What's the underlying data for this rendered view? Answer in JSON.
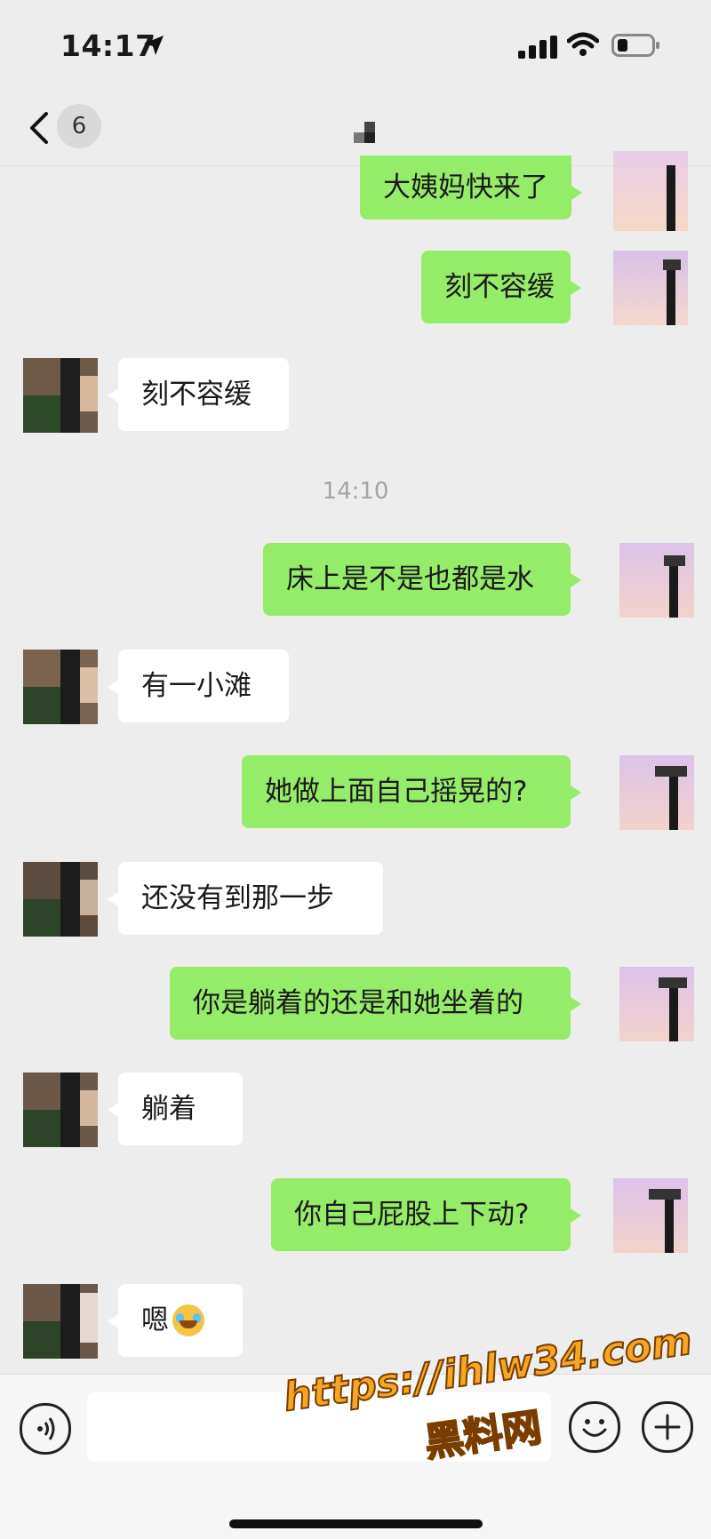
{
  "status_bar": {
    "time": "14:17"
  },
  "nav": {
    "unread_badge": "6"
  },
  "messages": [
    {
      "side": "out",
      "text": "大姨妈快来了"
    },
    {
      "side": "out",
      "text": "刻不容缓"
    },
    {
      "side": "in",
      "text": "刻不容缓"
    },
    {
      "side": "out",
      "text": "床上是不是也都是水"
    },
    {
      "side": "in",
      "text": "有一小滩"
    },
    {
      "side": "out",
      "text": "她做上面自己摇晃的?"
    },
    {
      "side": "in",
      "text": "还没有到那一步"
    },
    {
      "side": "out",
      "text": "你是躺着的还是和她坐着的"
    },
    {
      "side": "in",
      "text": "躺着"
    },
    {
      "side": "out",
      "text": "你自己屁股上下动?"
    },
    {
      "side": "in",
      "text": "嗯",
      "emoji": "crying-laughing-emoji"
    }
  ],
  "timestamp": "14:10",
  "watermark": {
    "url": "https://ihlw34.com",
    "name": "黑料网"
  },
  "colors": {
    "background": "#ededed",
    "outgoing_bubble": "#95ec69",
    "incoming_bubble": "#ffffff",
    "watermark": "#f5a623"
  },
  "icons": [
    "location-arrow-icon",
    "signal-icon",
    "wifi-icon",
    "battery-icon",
    "back-chevron-icon",
    "voice-icon",
    "emoji-icon",
    "plus-icon"
  ]
}
